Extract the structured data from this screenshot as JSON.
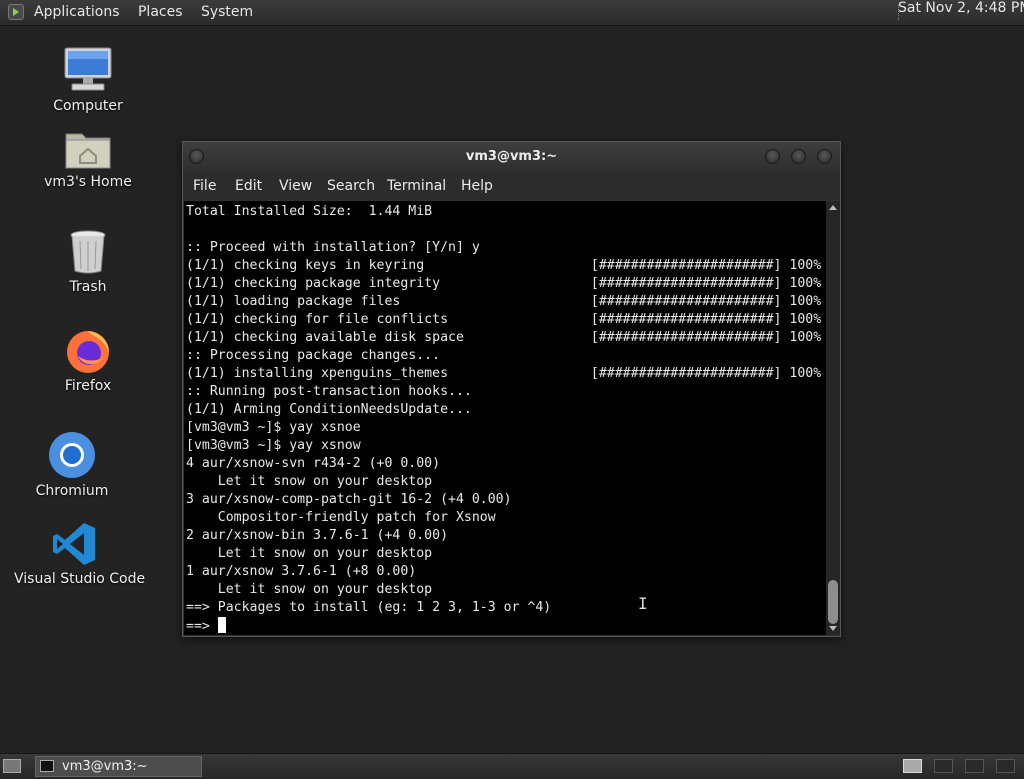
{
  "top_panel": {
    "menus": [
      "Applications",
      "Places",
      "System"
    ],
    "clock": "Sat Nov 2,  4:48 PM"
  },
  "desktop_icons": [
    {
      "label": "Computer",
      "icon": "computer-icon"
    },
    {
      "label": "vm3's Home",
      "icon": "home-folder-icon"
    },
    {
      "label": "Trash",
      "icon": "trash-icon"
    },
    {
      "label": "Firefox",
      "icon": "firefox-icon"
    },
    {
      "label": "Chromium",
      "icon": "chromium-icon"
    },
    {
      "label": "Visual Studio Code",
      "icon": "vscode-icon"
    }
  ],
  "window": {
    "title": "vm3@vm3:~",
    "menus": [
      "File",
      "Edit",
      "View",
      "Search",
      "Terminal",
      "Help"
    ]
  },
  "terminal": {
    "lines": [
      "Total Installed Size:  1.44 MiB",
      "",
      ":: Proceed with installation? [Y/n] y",
      "(1/1) checking keys in keyring                     [######################] 100%",
      "(1/1) checking package integrity                   [######################] 100%",
      "(1/1) loading package files                        [######################] 100%",
      "(1/1) checking for file conflicts                  [######################] 100%",
      "(1/1) checking available disk space                [######################] 100%",
      ":: Processing package changes...",
      "(1/1) installing xpenguins_themes                  [######################] 100%",
      ":: Running post-transaction hooks...",
      "(1/1) Arming ConditionNeedsUpdate...",
      "[vm3@vm3 ~]$ yay xsnoe",
      "[vm3@vm3 ~]$ yay xsnow",
      "4 aur/xsnow-svn r434-2 (+0 0.00)",
      "    Let it snow on your desktop",
      "3 aur/xsnow-comp-patch-git 16-2 (+4 0.00)",
      "    Compositor-friendly patch for Xsnow",
      "2 aur/xsnow-bin 3.7.6-1 (+4 0.00)",
      "    Let it snow on your desktop",
      "1 aur/xsnow 3.7.6-1 (+8 0.00)",
      "    Let it snow on your desktop",
      "==> Packages to install (eg: 1 2 3, 1-3 or ^4)"
    ],
    "prompt": "==> "
  },
  "taskbar": {
    "task_label": "vm3@vm3:~"
  },
  "colors": {
    "desktop_bg": "#232323",
    "terminal_bg": "#000000",
    "terminal_fg": "#e8e8e8",
    "firefox_orange": "#ff7139",
    "chromium_blue": "#4a8fe0",
    "vscode_blue": "#1f8ad2"
  }
}
